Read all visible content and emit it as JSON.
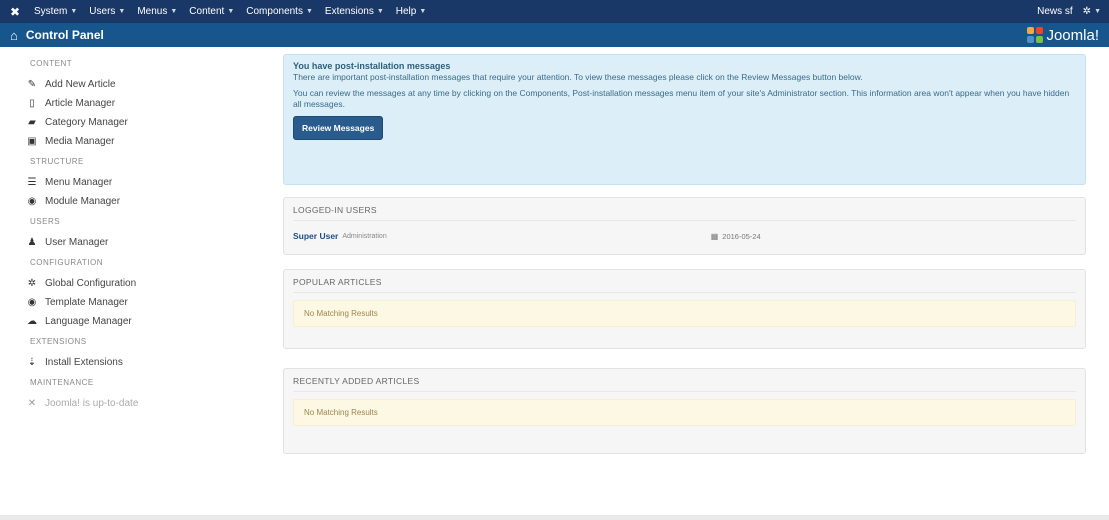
{
  "navbar": {
    "menu": [
      {
        "label": "System"
      },
      {
        "label": "Users"
      },
      {
        "label": "Menus"
      },
      {
        "label": "Content"
      },
      {
        "label": "Components"
      },
      {
        "label": "Extensions"
      },
      {
        "label": "Help"
      }
    ],
    "site_link": "News sf",
    "user_icon": "gear-icon"
  },
  "header": {
    "title": "Control Panel",
    "logo_text": "Joomla!"
  },
  "sidebar": {
    "sections": [
      {
        "heading": "CONTENT",
        "items": [
          {
            "label": "Add New Article",
            "icon": "✎"
          },
          {
            "label": "Article Manager",
            "icon": "▯"
          },
          {
            "label": "Category Manager",
            "icon": "▰"
          },
          {
            "label": "Media Manager",
            "icon": "▣"
          }
        ]
      },
      {
        "heading": "STRUCTURE",
        "items": [
          {
            "label": "Menu Manager",
            "icon": "☰"
          },
          {
            "label": "Module Manager",
            "icon": "◉"
          }
        ]
      },
      {
        "heading": "USERS",
        "items": [
          {
            "label": "User Manager",
            "icon": "♟"
          }
        ]
      },
      {
        "heading": "CONFIGURATION",
        "items": [
          {
            "label": "Global Configuration",
            "icon": "✲"
          },
          {
            "label": "Template Manager",
            "icon": "◉"
          },
          {
            "label": "Language Manager",
            "icon": "☁"
          }
        ]
      },
      {
        "heading": "EXTENSIONS",
        "items": [
          {
            "label": "Install Extensions",
            "icon": "⇣"
          }
        ]
      },
      {
        "heading": "MAINTENANCE",
        "items": [
          {
            "label": "Joomla! is up-to-date",
            "icon": "✕"
          }
        ]
      }
    ]
  },
  "alert": {
    "title": "You have post-installation messages",
    "line1": "There are important post-installation messages that require your attention. To view these messages please click on the Review Messages button below.",
    "line2": "You can review the messages at any time by clicking on the Components, Post-installation messages menu item of your site's Administrator section. This information area won't appear when you have hidden all messages.",
    "button": "Review Messages"
  },
  "logged_in_users": {
    "title": "LOGGED-IN USERS",
    "rows": [
      {
        "name": "Super User",
        "role": "Administration",
        "date": "2016-05-24"
      }
    ]
  },
  "popular_articles": {
    "title": "POPULAR ARTICLES",
    "empty": "No Matching Results"
  },
  "recent_articles": {
    "title": "RECENTLY ADDED ARTICLES",
    "empty": "No Matching Results"
  }
}
